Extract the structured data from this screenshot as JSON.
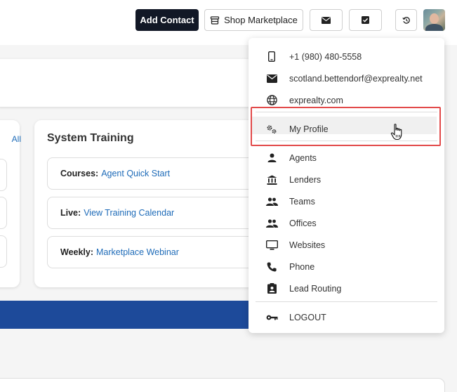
{
  "topbar": {
    "add_contact": "Add Contact",
    "shop_marketplace": "Shop Marketplace"
  },
  "training": {
    "all_link": "All",
    "title": "System Training",
    "rows": [
      {
        "label": "Courses:",
        "link": "Agent Quick Start"
      },
      {
        "label": "Live:",
        "link": "View Training Calendar"
      },
      {
        "label": "Weekly:",
        "link": "Marketplace Webinar"
      }
    ]
  },
  "menu": {
    "phone": "+1 (980) 480-5558",
    "email": "scotland.bettendorf@exprealty.net",
    "website": "exprealty.com",
    "my_profile": "My Profile",
    "agents": "Agents",
    "lenders": "Lenders",
    "teams": "Teams",
    "offices": "Offices",
    "websites": "Websites",
    "phone_item": "Phone",
    "lead_routing": "Lead Routing",
    "logout": "LOGOUT"
  },
  "colors": {
    "primary_dark": "#121826",
    "link_blue": "#1e6bb8",
    "band_blue": "#1d4a9a",
    "highlight_red": "#e24a4a"
  },
  "icons": [
    "store-icon",
    "mail-icon",
    "check-square-icon",
    "history-icon",
    "phone-icon",
    "email-icon",
    "globe-icon",
    "gears-icon",
    "person-icon",
    "bank-icon",
    "group-icon",
    "monitor-icon",
    "handset-icon",
    "clipboard-user-icon",
    "key-icon",
    "hand-cursor-icon"
  ]
}
